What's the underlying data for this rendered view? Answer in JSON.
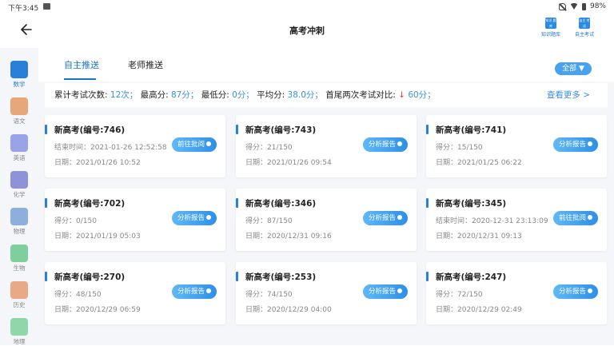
{
  "status": {
    "time": "下午3:45",
    "battery": "98%"
  },
  "header": {
    "title": "高考冲刺",
    "btn1_label": "知识题库",
    "btn2_label": "自主考试",
    "btn1_icon": "知识\n题库",
    "btn2_icon": "自主\n考试"
  },
  "sidebar": [
    {
      "label": "数学",
      "color": "#2a7fd6",
      "active": true
    },
    {
      "label": "语文",
      "color": "#e8a77a"
    },
    {
      "label": "英语",
      "color": "#9aa3e8"
    },
    {
      "label": "化学",
      "color": "#8e92d8"
    },
    {
      "label": "物理",
      "color": "#8eaede"
    },
    {
      "label": "生物",
      "color": "#7fcf9c"
    },
    {
      "label": "历史",
      "color": "#e9a987"
    },
    {
      "label": "地理",
      "color": "#8fd6a8"
    }
  ],
  "tabs": [
    "自主推送",
    "老师推送"
  ],
  "filter": {
    "label": "全部 ▼"
  },
  "stats": {
    "count_label": "累计考试次数:",
    "count": "12次",
    "max_label": "最高分:",
    "max": "87分",
    "min_label": "最低分:",
    "min": "0分",
    "avg_label": "平均分:",
    "avg": "38.0分",
    "cmp_label": "首尾两次考试对比:",
    "cmp_arrow": "↓",
    "cmp": "60分",
    "sep": "；",
    "more": "查看更多 >"
  },
  "cards": [
    {
      "title": "新高考(编号:746)",
      "line1": "结束时间：2021-01-26 12:52:58",
      "line2": "日期：2021/01/26 10:52",
      "action": "前往批阅"
    },
    {
      "title": "新高考(编号:743)",
      "line1": "得分：21/150",
      "line2": "日期：2021/01/26 09:54",
      "action": "分析报告"
    },
    {
      "title": "新高考(编号:741)",
      "line1": "得分：15/150",
      "line2": "日期：2021/01/25 06:22",
      "action": "分析报告"
    },
    {
      "title": "新高考(编号:702)",
      "line1": "得分：0/150",
      "line2": "日期：2021/01/19 05:03",
      "action": "分析报告"
    },
    {
      "title": "新高考(编号:346)",
      "line1": "得分：87/150",
      "line2": "日期：2020/12/31 09:16",
      "action": "分析报告"
    },
    {
      "title": "新高考(编号:345)",
      "line1": "结束时间：2020-12-31 23:13:09",
      "line2": "日期：2020/12/31 09:13",
      "action": "前往批阅"
    },
    {
      "title": "新高考(编号:270)",
      "line1": "得分：48/150",
      "line2": "日期：2020/12/29 06:59",
      "action": "分析报告"
    },
    {
      "title": "新高考(编号:253)",
      "line1": "得分：74/150",
      "line2": "日期：2020/12/29 04:00",
      "action": "分析报告"
    },
    {
      "title": "新高考(编号:247)",
      "line1": "得分：72/150",
      "line2": "日期：2020/12/29 02:49",
      "action": "分析报告"
    }
  ]
}
